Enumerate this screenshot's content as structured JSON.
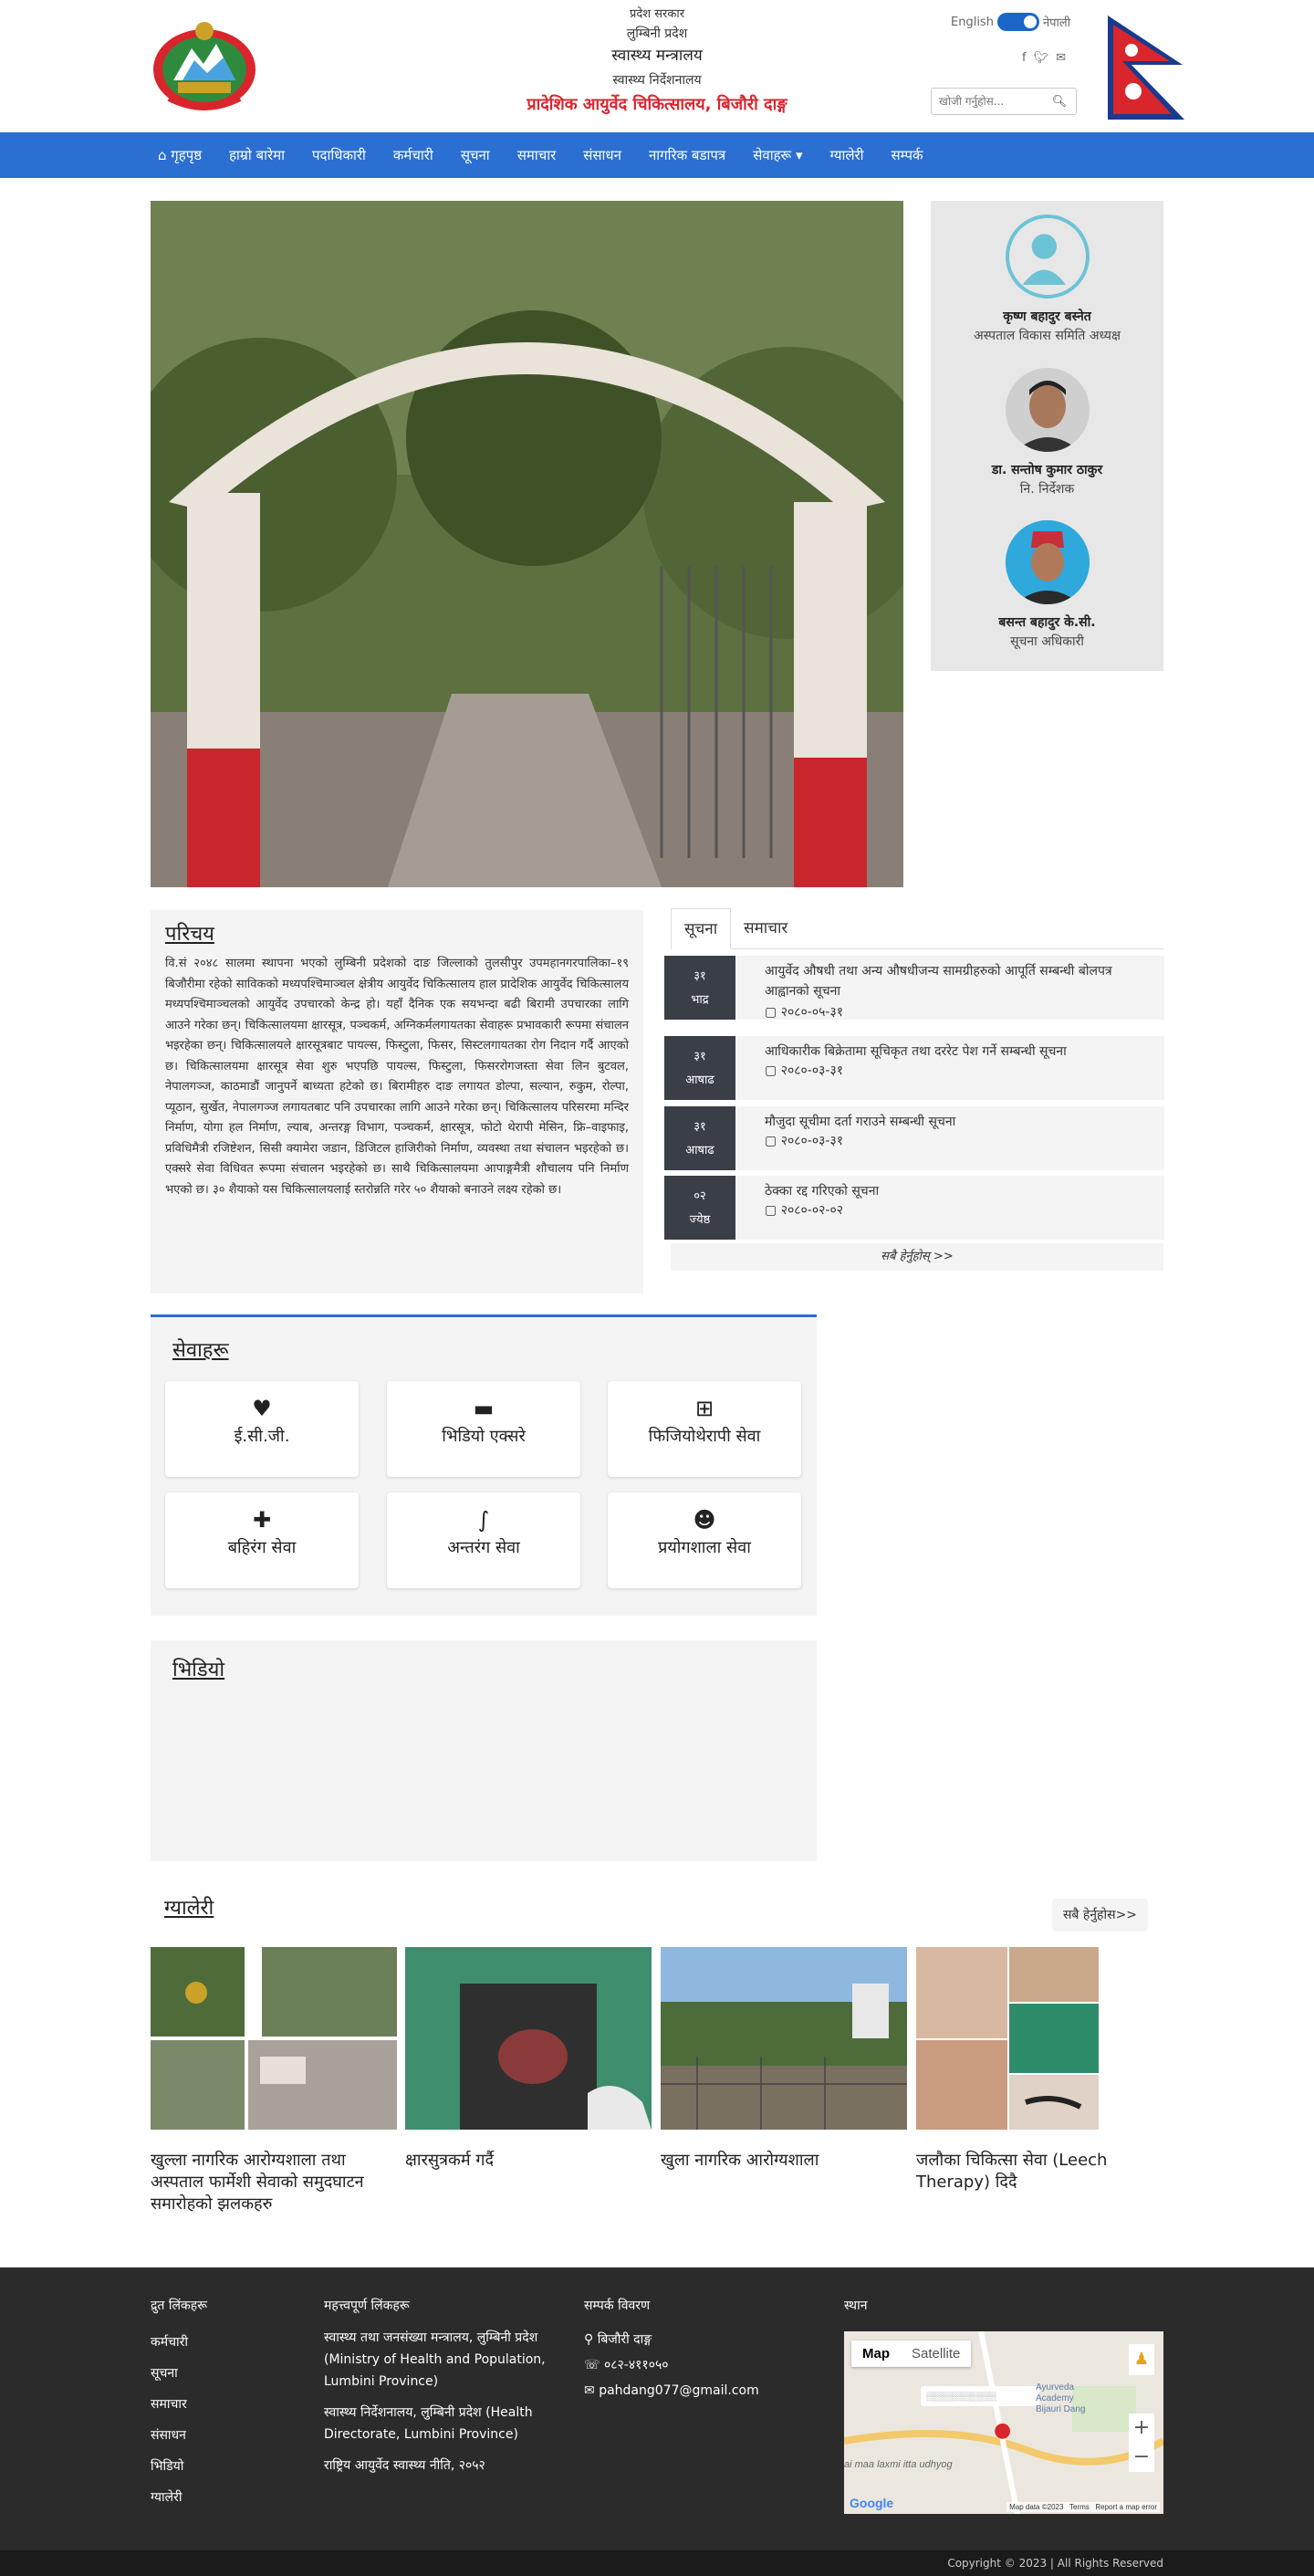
{
  "header": {
    "gov_line1": "प्रदेश सरकार",
    "gov_line2": "लुम्बिनी प्रदेश",
    "ministry": "स्वास्थ्य मन्त्रालय",
    "directorate": "स्वास्थ्य निर्देशनालय",
    "hospital": "प्रादेशिक आयुर्वेद चिकित्सालय, बिजौरी दाङ्ग",
    "lang_en": "English",
    "lang_np": "नेपाली",
    "search_placeholder": "खोजी गर्नुहोस..."
  },
  "nav": {
    "items": [
      "गृहपृष्ठ",
      "हाम्रो बारेमा",
      "पदाधिकारी",
      "कर्मचारी",
      "सूचना",
      "समाचार",
      "संसाधन",
      "नागरिक बडापत्र",
      "सेवाहरू",
      "ग्यालेरी",
      "सम्पर्क"
    ]
  },
  "officials": [
    {
      "name": "कृष्ण बहादुर बस्नेत",
      "role": "अस्पताल विकास समिति अध्यक्ष"
    },
    {
      "name": "डा. सन्तोष कुमार ठाकुर",
      "role": "नि. निर्देशक"
    },
    {
      "name": "बसन्त बहादुर के.सी.",
      "role": "सूचना अधिकारी"
    }
  ],
  "intro": {
    "title": "परिचय",
    "text": "वि.सं २०४८ सालमा स्थापना भएको लुम्बिनी प्रदेशको दाङ जिल्लाको तुलसीपुर उपमहानगरपालिका–१९ बिजौरीमा रहेको साविकको मध्यपश्चिमाञ्चल क्षेत्रीय आयुर्वेद चिकित्सालय हाल प्रादेशिक आयुर्वेद चिकित्सालय मध्यपश्चिमाञ्चलको आयुर्वेद उपचारको केन्द्र हो। यहाँ दैनिक एक सयभन्दा बढी बिरामी उपचारका लागि आउने गरेका छन्। चिकित्सालयमा क्षारसूत्र, पञ्चकर्म, अग्निकर्मलगायतका सेवाहरू प्रभावकारी रूपमा संचालन भइरहेका छन्। चिकित्सालयले क्षारसूत्रबाट पायल्स, फिस्टुला, फिसर, सिस्टलगायतका रोग निदान गर्दै आएको छ। चिकित्सालयमा क्षारसूत्र सेवा शुरु भएपछि पायल्स, फिस्टुला, फिसररोगजस्ता सेवा लिन बुटवल, नेपालगञ्ज, काठमाडौं जानुपर्ने बाध्यता हटेको छ। बिरामीहरु दाङ लगायत डोल्पा, सल्यान, रुकुम, रोल्पा, प्यूठान, सुर्खेत, नेपालगञ्ज लगायतबाट पनि उपचारका लागि आउने गरेका छन्। चिकित्सालय परिसरमा मन्दिर निर्माण, योगा हल निर्माण, ल्याब, अन्तरङ्ग विभाग, पञ्चकर्म, क्षारसूत्र, फोटो थेरापी मेसिन, फ्रि–वाइफाइ, प्रविधिमैत्री रजिष्टेशन, सिसी क्यामेरा जडान, डिजिटल हाजिरीको निर्माण, व्यवस्था तथा संचालन भइरहेको छ। एक्सरे सेवा विधिवत रूपमा संचालन भइरहेको छ। साथै चिकित्सालयमा आपाङ्गमैत्री शौचालय पनि निर्माण भएको छ। ३० शैयाको यस चिकित्सालयलाई स्तरोन्नति गरेर ५० शैयाको बनाउने लक्ष्य रहेको छ।"
  },
  "notices": {
    "tabs": [
      "सूचना",
      "समाचार"
    ],
    "items": [
      {
        "day": "३१",
        "month": "भाद्र",
        "title": "आयुर्वेद औषधी तथा अन्य औषधीजन्य सामग्रीहरुको आपूर्ति सम्बन्धी बोलपत्र आह्वानको सूचना",
        "date": "२०८०-०५-३१"
      },
      {
        "day": "३१",
        "month": "आषाढ",
        "title": "आधिकारीक बिक्रेतामा सूचिकृत तथा दररेट पेश गर्ने सम्बन्धी सूचना",
        "date": "२०८०-०३-३१"
      },
      {
        "day": "३१",
        "month": "आषाढ",
        "title": "मौजुदा सूचीमा दर्ता गराउने सम्बन्धी सूचना",
        "date": "२०८०-०३-३१"
      },
      {
        "day": "०२",
        "month": "ज्येष्ठ",
        "title": "ठेक्का रद्द गरिएको सूचना",
        "date": "२०८०-०२-०२"
      }
    ],
    "see_all": "सबै हेर्नुहोस् >>"
  },
  "services": {
    "title": "सेवाहरू",
    "items": [
      {
        "icon": "heartbeat-icon",
        "label": "ई.सी.जी."
      },
      {
        "icon": "card-icon",
        "label": "भिडियो एक्सरे"
      },
      {
        "icon": "plus-square-icon",
        "label": "फिजियोथेरापी सेवा"
      },
      {
        "icon": "medkit-icon",
        "label": "बहिरंग सेवा"
      },
      {
        "icon": "stethoscope-icon",
        "label": "अन्तरंग सेवा"
      },
      {
        "icon": "doctor-icon",
        "label": "प्रयोगशाला सेवा"
      }
    ]
  },
  "video": {
    "title": "भिडियो"
  },
  "gallery": {
    "title": "ग्यालेरी",
    "see_more": "सबै हेर्नुहोस>>",
    "items": [
      {
        "caption": "खुल्ला नागरिक आरोग्यशाला तथा अस्पताल फार्मेशी सेवाको समुदघाटन समारोहको झलकहरु"
      },
      {
        "caption": "क्षारसुत्रकर्म गर्दै"
      },
      {
        "caption": "खुला नागरिक आरोग्यशाला"
      },
      {
        "caption": "जलौका चिकित्सा सेवा (Leech Therapy) दिदै"
      }
    ]
  },
  "footer": {
    "quick_title": "द्रुत लिंकहरू",
    "quick_links": [
      "कर्मचारी",
      "सूचना",
      "समाचार",
      "संसाधन",
      "भिडियो",
      "ग्यालेरी"
    ],
    "important_title": "महत्त्वपूर्ण लिंकहरू",
    "important_links": [
      "स्वास्थ्य तथा जनसंख्या मन्त्रालय, लुम्बिनी प्रदेश (Ministry of Health and Population, Lumbini Province)",
      "स्वास्थ्य निर्देशनालय, लुम्बिनी प्रदेश (Health Directorate, Lumbini Province)",
      "राष्ट्रिय आयुर्वेद स्वास्थ्य नीति, २०५२"
    ],
    "contact_title": "सम्पर्क विवरण",
    "address": "बिजौरी दाङ्ग",
    "phone": "०८२-४११०५०",
    "email": "pahdang077@gmail.com",
    "location_title": "स्थान",
    "map_btn_map": "Map",
    "map_btn_sat": "Satellite",
    "map_place_label": "Ayurveda Academy Bijauri Dang",
    "map_road_label": "ai maa laxmi itta udhyog",
    "map_data": "Map data ©2023",
    "map_terms": "Terms",
    "map_report": "Report a map error",
    "map_google": "Google",
    "copyright": "Copyright © 2023 | All Rights Reserved"
  }
}
